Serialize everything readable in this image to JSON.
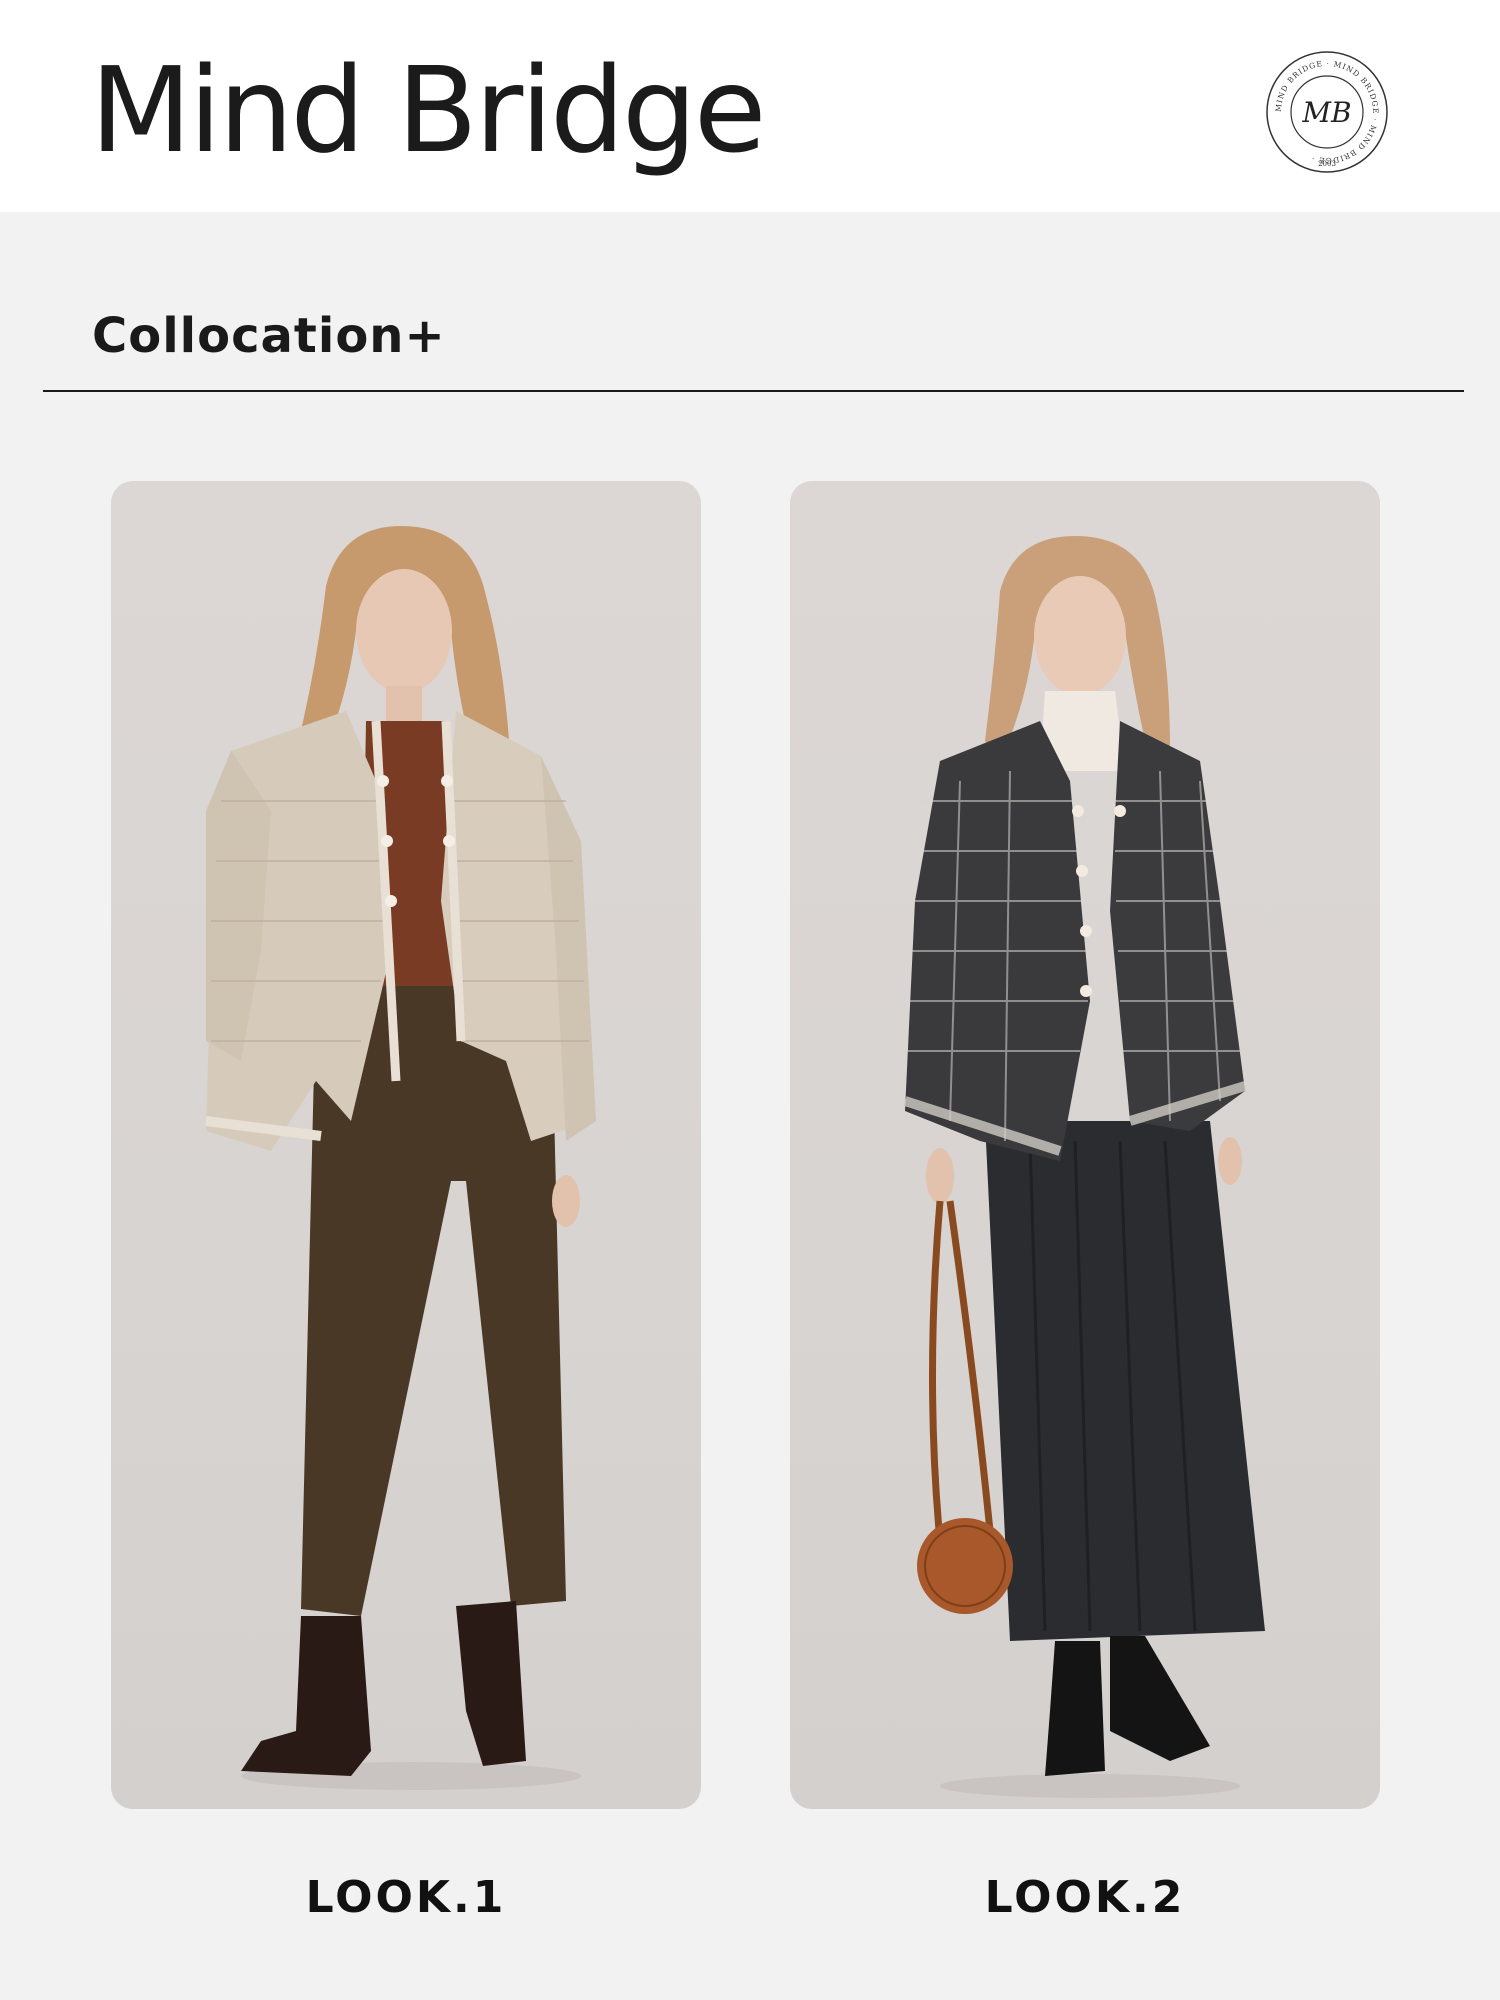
{
  "brand": {
    "name": "Mind Bridge",
    "seal": {
      "monogram": "MB",
      "ring_text": "MIND BRIDGE · MIND BRIDGE · MIND BRIDGE ·",
      "year": "2003"
    }
  },
  "section": {
    "title": "Collocation+"
  },
  "looks": [
    {
      "label": "LOOK.1"
    },
    {
      "label": "LOOK.2"
    }
  ],
  "colors": {
    "header_bg": "#ffffff",
    "page_bg": "#f2f2f2",
    "card_bg": "#d9d5d3",
    "text": "#111111"
  }
}
